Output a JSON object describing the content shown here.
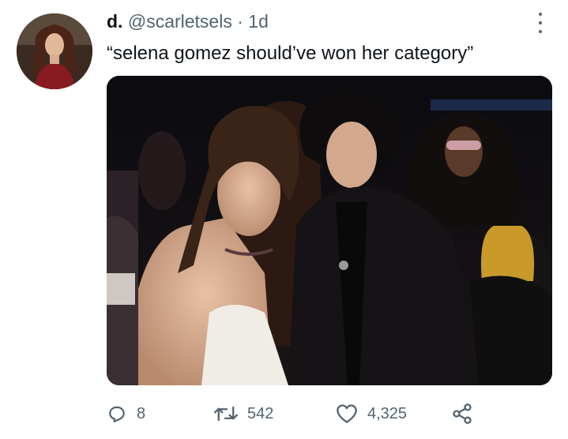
{
  "tweet": {
    "display_name": "d.",
    "handle": "@scarletsels",
    "separator": "·",
    "time_ago": "1d",
    "text": "“selena gomez should’ve won her category”"
  },
  "actions": {
    "reply_count": "8",
    "retweet_count": "542",
    "like_count": "4,325"
  },
  "icons": {
    "avatar": "avatar",
    "more": "more-options-icon",
    "reply": "reply-icon",
    "retweet": "retweet-icon",
    "like": "heart-icon",
    "share": "share-icon"
  },
  "colors": {
    "text_primary": "#0f1419",
    "text_secondary": "#536471"
  }
}
